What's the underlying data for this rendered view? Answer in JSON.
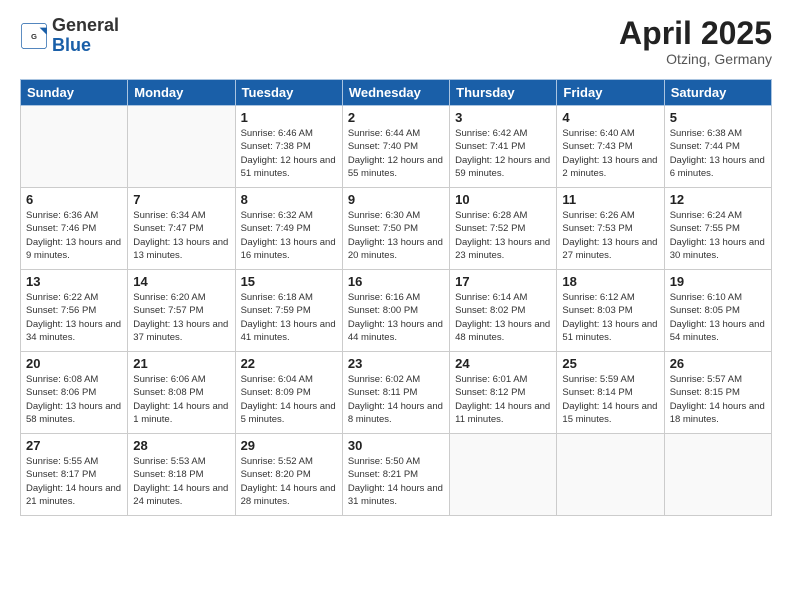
{
  "logo": {
    "general": "General",
    "blue": "Blue"
  },
  "title": "April 2025",
  "location": "Otzing, Germany",
  "days_header": [
    "Sunday",
    "Monday",
    "Tuesday",
    "Wednesday",
    "Thursday",
    "Friday",
    "Saturday"
  ],
  "weeks": [
    [
      {
        "day": "",
        "info": ""
      },
      {
        "day": "",
        "info": ""
      },
      {
        "day": "1",
        "info": "Sunrise: 6:46 AM\nSunset: 7:38 PM\nDaylight: 12 hours and 51 minutes."
      },
      {
        "day": "2",
        "info": "Sunrise: 6:44 AM\nSunset: 7:40 PM\nDaylight: 12 hours and 55 minutes."
      },
      {
        "day": "3",
        "info": "Sunrise: 6:42 AM\nSunset: 7:41 PM\nDaylight: 12 hours and 59 minutes."
      },
      {
        "day": "4",
        "info": "Sunrise: 6:40 AM\nSunset: 7:43 PM\nDaylight: 13 hours and 2 minutes."
      },
      {
        "day": "5",
        "info": "Sunrise: 6:38 AM\nSunset: 7:44 PM\nDaylight: 13 hours and 6 minutes."
      }
    ],
    [
      {
        "day": "6",
        "info": "Sunrise: 6:36 AM\nSunset: 7:46 PM\nDaylight: 13 hours and 9 minutes."
      },
      {
        "day": "7",
        "info": "Sunrise: 6:34 AM\nSunset: 7:47 PM\nDaylight: 13 hours and 13 minutes."
      },
      {
        "day": "8",
        "info": "Sunrise: 6:32 AM\nSunset: 7:49 PM\nDaylight: 13 hours and 16 minutes."
      },
      {
        "day": "9",
        "info": "Sunrise: 6:30 AM\nSunset: 7:50 PM\nDaylight: 13 hours and 20 minutes."
      },
      {
        "day": "10",
        "info": "Sunrise: 6:28 AM\nSunset: 7:52 PM\nDaylight: 13 hours and 23 minutes."
      },
      {
        "day": "11",
        "info": "Sunrise: 6:26 AM\nSunset: 7:53 PM\nDaylight: 13 hours and 27 minutes."
      },
      {
        "day": "12",
        "info": "Sunrise: 6:24 AM\nSunset: 7:55 PM\nDaylight: 13 hours and 30 minutes."
      }
    ],
    [
      {
        "day": "13",
        "info": "Sunrise: 6:22 AM\nSunset: 7:56 PM\nDaylight: 13 hours and 34 minutes."
      },
      {
        "day": "14",
        "info": "Sunrise: 6:20 AM\nSunset: 7:57 PM\nDaylight: 13 hours and 37 minutes."
      },
      {
        "day": "15",
        "info": "Sunrise: 6:18 AM\nSunset: 7:59 PM\nDaylight: 13 hours and 41 minutes."
      },
      {
        "day": "16",
        "info": "Sunrise: 6:16 AM\nSunset: 8:00 PM\nDaylight: 13 hours and 44 minutes."
      },
      {
        "day": "17",
        "info": "Sunrise: 6:14 AM\nSunset: 8:02 PM\nDaylight: 13 hours and 48 minutes."
      },
      {
        "day": "18",
        "info": "Sunrise: 6:12 AM\nSunset: 8:03 PM\nDaylight: 13 hours and 51 minutes."
      },
      {
        "day": "19",
        "info": "Sunrise: 6:10 AM\nSunset: 8:05 PM\nDaylight: 13 hours and 54 minutes."
      }
    ],
    [
      {
        "day": "20",
        "info": "Sunrise: 6:08 AM\nSunset: 8:06 PM\nDaylight: 13 hours and 58 minutes."
      },
      {
        "day": "21",
        "info": "Sunrise: 6:06 AM\nSunset: 8:08 PM\nDaylight: 14 hours and 1 minute."
      },
      {
        "day": "22",
        "info": "Sunrise: 6:04 AM\nSunset: 8:09 PM\nDaylight: 14 hours and 5 minutes."
      },
      {
        "day": "23",
        "info": "Sunrise: 6:02 AM\nSunset: 8:11 PM\nDaylight: 14 hours and 8 minutes."
      },
      {
        "day": "24",
        "info": "Sunrise: 6:01 AM\nSunset: 8:12 PM\nDaylight: 14 hours and 11 minutes."
      },
      {
        "day": "25",
        "info": "Sunrise: 5:59 AM\nSunset: 8:14 PM\nDaylight: 14 hours and 15 minutes."
      },
      {
        "day": "26",
        "info": "Sunrise: 5:57 AM\nSunset: 8:15 PM\nDaylight: 14 hours and 18 minutes."
      }
    ],
    [
      {
        "day": "27",
        "info": "Sunrise: 5:55 AM\nSunset: 8:17 PM\nDaylight: 14 hours and 21 minutes."
      },
      {
        "day": "28",
        "info": "Sunrise: 5:53 AM\nSunset: 8:18 PM\nDaylight: 14 hours and 24 minutes."
      },
      {
        "day": "29",
        "info": "Sunrise: 5:52 AM\nSunset: 8:20 PM\nDaylight: 14 hours and 28 minutes."
      },
      {
        "day": "30",
        "info": "Sunrise: 5:50 AM\nSunset: 8:21 PM\nDaylight: 14 hours and 31 minutes."
      },
      {
        "day": "",
        "info": ""
      },
      {
        "day": "",
        "info": ""
      },
      {
        "day": "",
        "info": ""
      }
    ]
  ]
}
